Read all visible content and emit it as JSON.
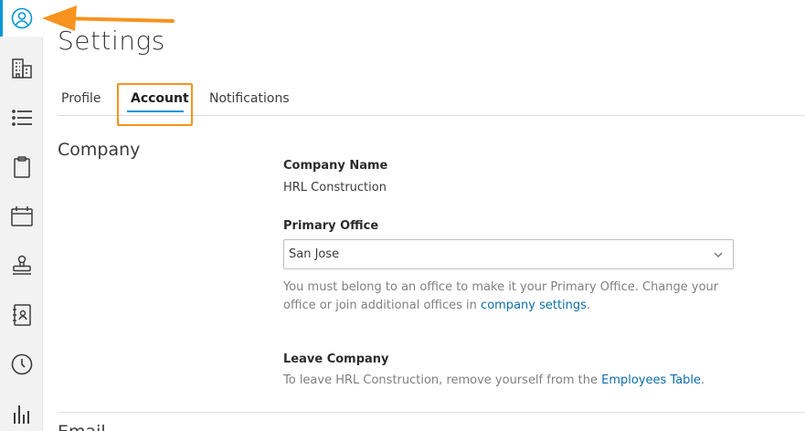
{
  "page": {
    "title": "Settings"
  },
  "sidebar": {
    "items": [
      {
        "icon": "user-circle-icon",
        "active": true
      },
      {
        "icon": "building-icon",
        "active": false
      },
      {
        "icon": "list-icon",
        "active": false
      },
      {
        "icon": "clipboard-icon",
        "active": false
      },
      {
        "icon": "calendar-icon",
        "active": false
      },
      {
        "icon": "stamp-icon",
        "active": false
      },
      {
        "icon": "address-book-icon",
        "active": false
      },
      {
        "icon": "clock-icon",
        "active": false
      },
      {
        "icon": "bar-chart-icon",
        "active": false
      }
    ],
    "accent": "#0696d7"
  },
  "tabs": [
    {
      "label": "Profile",
      "active": false
    },
    {
      "label": "Account",
      "active": true
    },
    {
      "label": "Notifications",
      "active": false
    }
  ],
  "company_section": {
    "heading": "Company",
    "company_name_label": "Company Name",
    "company_name_value": "HRL Construction",
    "primary_office_label": "Primary Office",
    "primary_office_value": "San Jose",
    "primary_office_help_1": "You must belong to an office to make it your Primary Office. Change your",
    "primary_office_help_2": "office or join additional offices in",
    "primary_office_help_link": "company settings",
    "primary_office_help_end": ".",
    "leave_label": "Leave Company",
    "leave_help": "To leave HRL Construction, remove yourself from the",
    "leave_help_link": "Employees Table",
    "leave_help_end": "."
  },
  "next_section": {
    "heading": "Email"
  },
  "annotation_color": "#f7931e",
  "link_color": "#0d6fab"
}
